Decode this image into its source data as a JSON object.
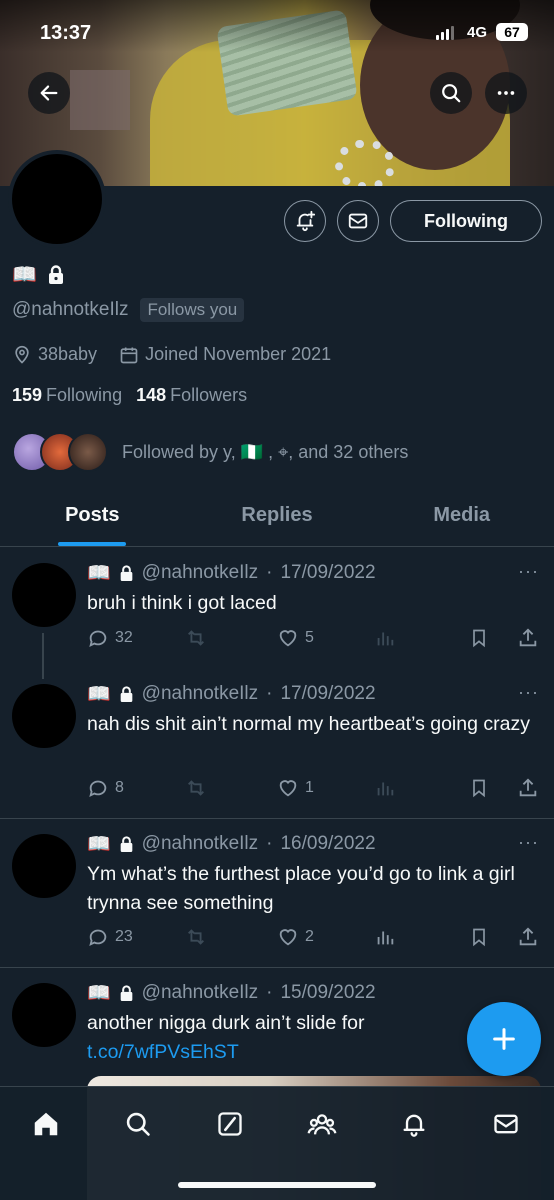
{
  "status_bar": {
    "time": "13:37",
    "network": "4G",
    "battery": "67"
  },
  "profile": {
    "display_name_emoji": "📖",
    "handle": "@nahnotkeIlz",
    "follows_you": "Follows you",
    "location": "38baby",
    "joined": "Joined November 2021",
    "following_count": "159",
    "following_label": "Following",
    "followers_count": "148",
    "followers_label": "Followers",
    "followed_by": "Followed by y, 🇳🇬 , ⌖, and 32 others",
    "following_button": "Following"
  },
  "tabs": [
    {
      "label": "Posts",
      "active": true
    },
    {
      "label": "Replies",
      "active": false
    },
    {
      "label": "Media",
      "active": false
    }
  ],
  "posts": [
    {
      "handle": "@nahnotkeIlz",
      "date": "17/09/2022",
      "text": "bruh i think i got laced",
      "replies": "32",
      "reposts": "",
      "likes": "5",
      "views": ""
    },
    {
      "handle": "@nahnotkeIlz",
      "date": "17/09/2022",
      "text": "nah dis shit ain’t normal my heartbeat’s going crazy",
      "replies": "8",
      "reposts": "",
      "likes": "1",
      "views": ""
    },
    {
      "handle": "@nahnotkeIlz",
      "date": "16/09/2022",
      "text": "Ym what’s the furthest place you’d go to link a girl trynna see something",
      "replies": "23",
      "reposts": "",
      "likes": "2",
      "views": ""
    },
    {
      "handle": "@nahnotkeIlz",
      "date": "15/09/2022",
      "text": "another nigga durk ain’t slide for ",
      "link": "t.co/7wfPVsEhST"
    }
  ],
  "colors": {
    "background": "#15202b",
    "accent": "#1d9bf0",
    "muted": "#8b98a5"
  }
}
